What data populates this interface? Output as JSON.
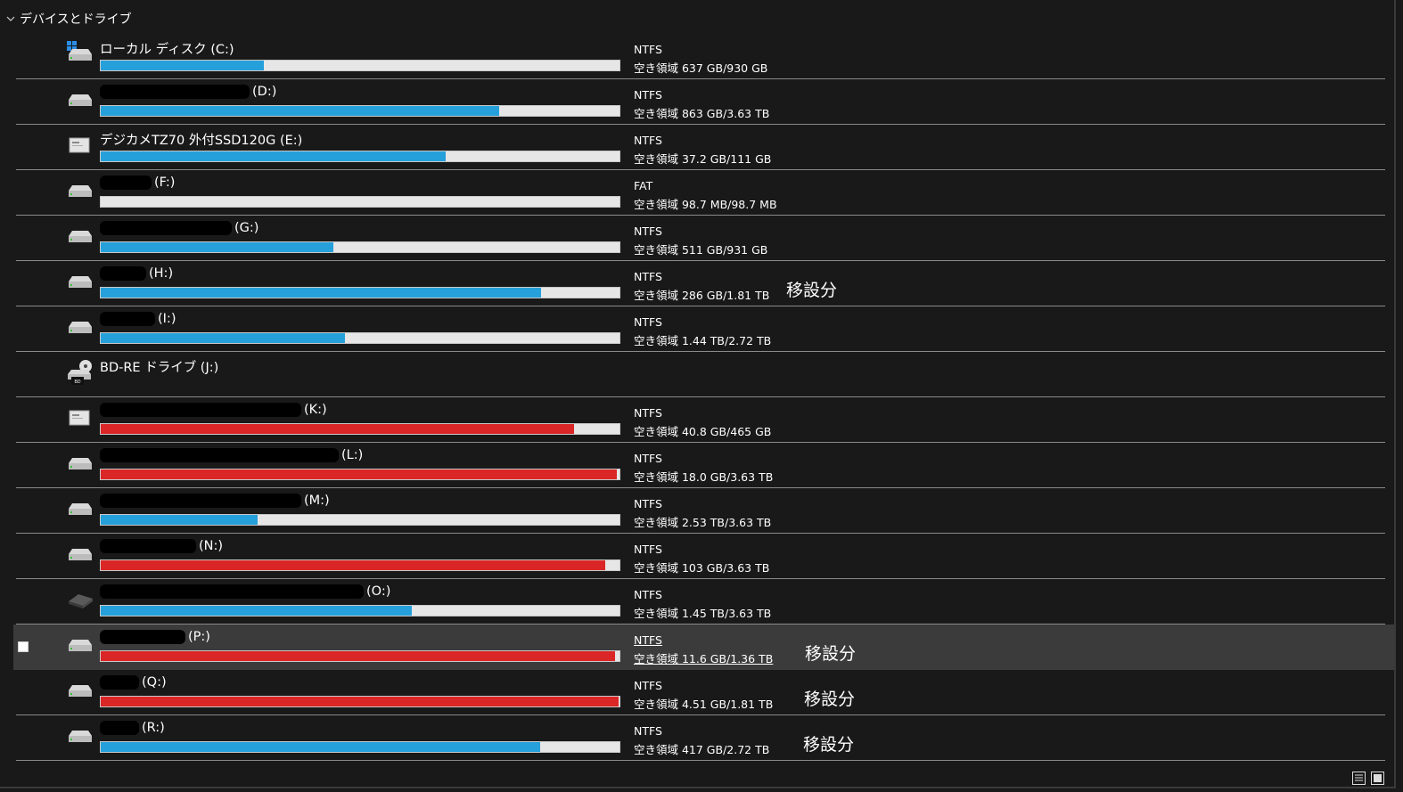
{
  "group": {
    "label": "デバイスとドライブ",
    "icon": "chevron-down-icon"
  },
  "colors": {
    "normal": "#26a0da",
    "full": "#da2626",
    "track": "#e6e6e6"
  },
  "drives": [
    {
      "name": "ローカル ディスク (C:)",
      "redacted": false,
      "icon": "windows-drive-icon",
      "fs": "NTFS",
      "free": "空き領域 637 GB/930 GB",
      "used": 0.315,
      "state": "normal",
      "note": ""
    },
    {
      "name": "(D:)",
      "redacted": true,
      "icon": "hdd-icon",
      "fs": "NTFS",
      "free": "空き領域 863 GB/3.63 TB",
      "used": 0.768,
      "state": "normal",
      "note": ""
    },
    {
      "name": "デジカメTZ70 外付SSD120G (E:)",
      "redacted": false,
      "icon": "ssd-icon",
      "fs": "NTFS",
      "free": "空き領域 37.2 GB/111 GB",
      "used": 0.665,
      "state": "normal",
      "note": ""
    },
    {
      "name": "(F:)",
      "redacted": true,
      "icon": "hdd-icon",
      "fs": "FAT",
      "free": "空き領域 98.7 MB/98.7 MB",
      "used": 0.0,
      "state": "normal",
      "note": ""
    },
    {
      "name": "(G:)",
      "redacted": true,
      "icon": "hdd-icon",
      "fs": "NTFS",
      "free": "空き領域 511 GB/931 GB",
      "used": 0.449,
      "state": "normal",
      "note": ""
    },
    {
      "name": "(H:)",
      "redacted": true,
      "icon": "hdd-icon",
      "fs": "NTFS",
      "free": "空き領域 286 GB/1.81 TB",
      "used": 0.849,
      "state": "normal",
      "note": "移設分"
    },
    {
      "name": "(I:)",
      "redacted": true,
      "icon": "hdd-icon",
      "fs": "NTFS",
      "free": "空き領域 1.44 TB/2.72 TB",
      "used": 0.471,
      "state": "normal",
      "note": ""
    },
    {
      "name": "BD-RE ドライブ (J:)",
      "redacted": false,
      "icon": "bd-drive-icon",
      "fs": "",
      "free": "",
      "used": null,
      "state": "none",
      "note": ""
    },
    {
      "name": "(K:)",
      "redacted": true,
      "icon": "ssd-icon",
      "fs": "NTFS",
      "free": "空き領域 40.8 GB/465 GB",
      "used": 0.912,
      "state": "full",
      "note": ""
    },
    {
      "name": "(L:)",
      "redacted": true,
      "icon": "hdd-icon",
      "fs": "NTFS",
      "free": "空き領域 18.0 GB/3.63 TB",
      "used": 0.995,
      "state": "full",
      "note": ""
    },
    {
      "name": "(M:)",
      "redacted": true,
      "icon": "hdd-icon",
      "fs": "NTFS",
      "free": "空き領域 2.53 TB/3.63 TB",
      "used": 0.303,
      "state": "normal",
      "note": ""
    },
    {
      "name": "(N:)",
      "redacted": true,
      "icon": "hdd-icon",
      "fs": "NTFS",
      "free": "空き領域 103 GB/3.63 TB",
      "used": 0.972,
      "state": "full",
      "note": ""
    },
    {
      "name": "(O:)",
      "redacted": true,
      "icon": "external-drive-icon",
      "fs": "NTFS",
      "free": "空き領域 1.45 TB/3.63 TB",
      "used": 0.6,
      "state": "normal",
      "note": ""
    },
    {
      "name": "(P:)",
      "redacted": true,
      "icon": "hdd-icon",
      "fs": "NTFS",
      "free": "空き領域 11.6 GB/1.36 TB",
      "used": 0.992,
      "state": "full",
      "note": "移設分",
      "selected": true
    },
    {
      "name": "(Q:)",
      "redacted": true,
      "icon": "hdd-icon",
      "fs": "NTFS",
      "free": "空き領域 4.51 GB/1.81 TB",
      "used": 0.998,
      "state": "full",
      "note": "移設分"
    },
    {
      "name": "(R:)",
      "redacted": true,
      "icon": "hdd-icon",
      "fs": "NTFS",
      "free": "空き領域 417 GB/2.72 TB",
      "used": 0.847,
      "state": "normal",
      "note": "移設分"
    }
  ],
  "view_buttons": [
    {
      "icon": "details-view-icon"
    },
    {
      "icon": "large-icons-view-icon"
    }
  ]
}
